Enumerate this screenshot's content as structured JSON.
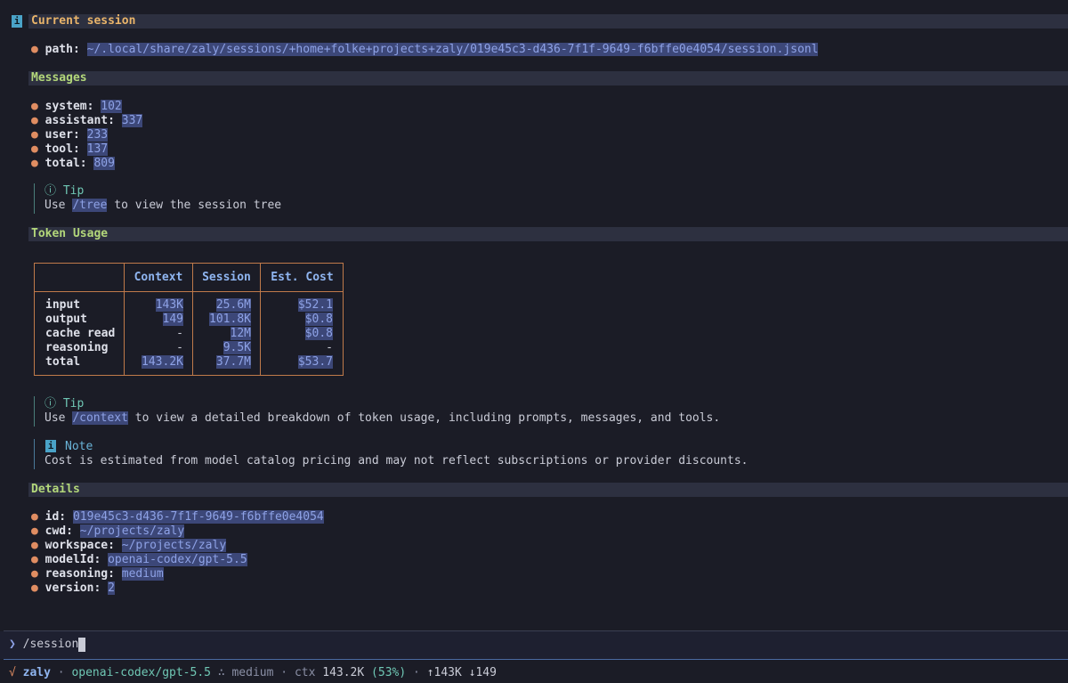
{
  "session": {
    "title": "Current session",
    "path_label": "path:",
    "path_value": "~/.local/share/zaly/sessions/+home+folke+projects+zaly/019e45c3-d436-7f1f-9649-f6bffe0e4054/session.jsonl"
  },
  "messages": {
    "heading": "Messages",
    "items": [
      {
        "label": "system:",
        "value": "102"
      },
      {
        "label": "assistant:",
        "value": "337"
      },
      {
        "label": "user:",
        "value": "233"
      },
      {
        "label": "tool:",
        "value": "137"
      },
      {
        "label": "total:",
        "value": "809"
      }
    ],
    "tip_title": "Tip",
    "tip_pre": "Use ",
    "tip_cmd": "/tree",
    "tip_post": " to view the session tree"
  },
  "tokens": {
    "heading": "Token Usage",
    "columns": [
      "Context",
      "Session",
      "Est. Cost"
    ],
    "rows": [
      {
        "label": "input",
        "context": "143K",
        "session": "25.6M",
        "cost": "$52.1"
      },
      {
        "label": "output",
        "context": "149",
        "session": "101.8K",
        "cost": "$0.8"
      },
      {
        "label": "cache read",
        "context": "-",
        "session": "12M",
        "cost": "$0.8"
      },
      {
        "label": "reasoning",
        "context": "-",
        "session": "9.5K",
        "cost": "-"
      },
      {
        "label": "total",
        "context": "143.2K",
        "session": "37.7M",
        "cost": "$53.7"
      }
    ],
    "tip_title": "Tip",
    "tip_pre": "Use ",
    "tip_cmd": "/context",
    "tip_post": " to view a detailed breakdown of token usage, including prompts, messages, and tools.",
    "note_title": "Note",
    "note_text": "Cost is estimated from model catalog pricing and may not reflect subscriptions or provider discounts."
  },
  "details": {
    "heading": "Details",
    "items": [
      {
        "label": "id:",
        "value": "019e45c3-d436-7f1f-9649-f6bffe0e4054"
      },
      {
        "label": "cwd:",
        "value": "~/projects/zaly"
      },
      {
        "label": "workspace:",
        "value": "~/projects/zaly"
      },
      {
        "label": "modelId:",
        "value": "openai-codex/gpt-5.5"
      },
      {
        "label": "reasoning:",
        "value": "medium"
      },
      {
        "label": "version:",
        "value": "2"
      }
    ]
  },
  "prompt": {
    "symbol": "❯",
    "input_value": "/session"
  },
  "status": {
    "check": "√",
    "app": "zaly",
    "model": "openai-codex/gpt-5.5",
    "reasoning_sym": "∴",
    "reasoning": "medium",
    "ctx_label": "ctx",
    "ctx_value": "143.2K",
    "ctx_pct": "(53%)",
    "tokens_up": "↑143K",
    "tokens_down": "↓149",
    "sep": "·"
  },
  "icons": {
    "info": "i",
    "tip": "ⓘ"
  }
}
